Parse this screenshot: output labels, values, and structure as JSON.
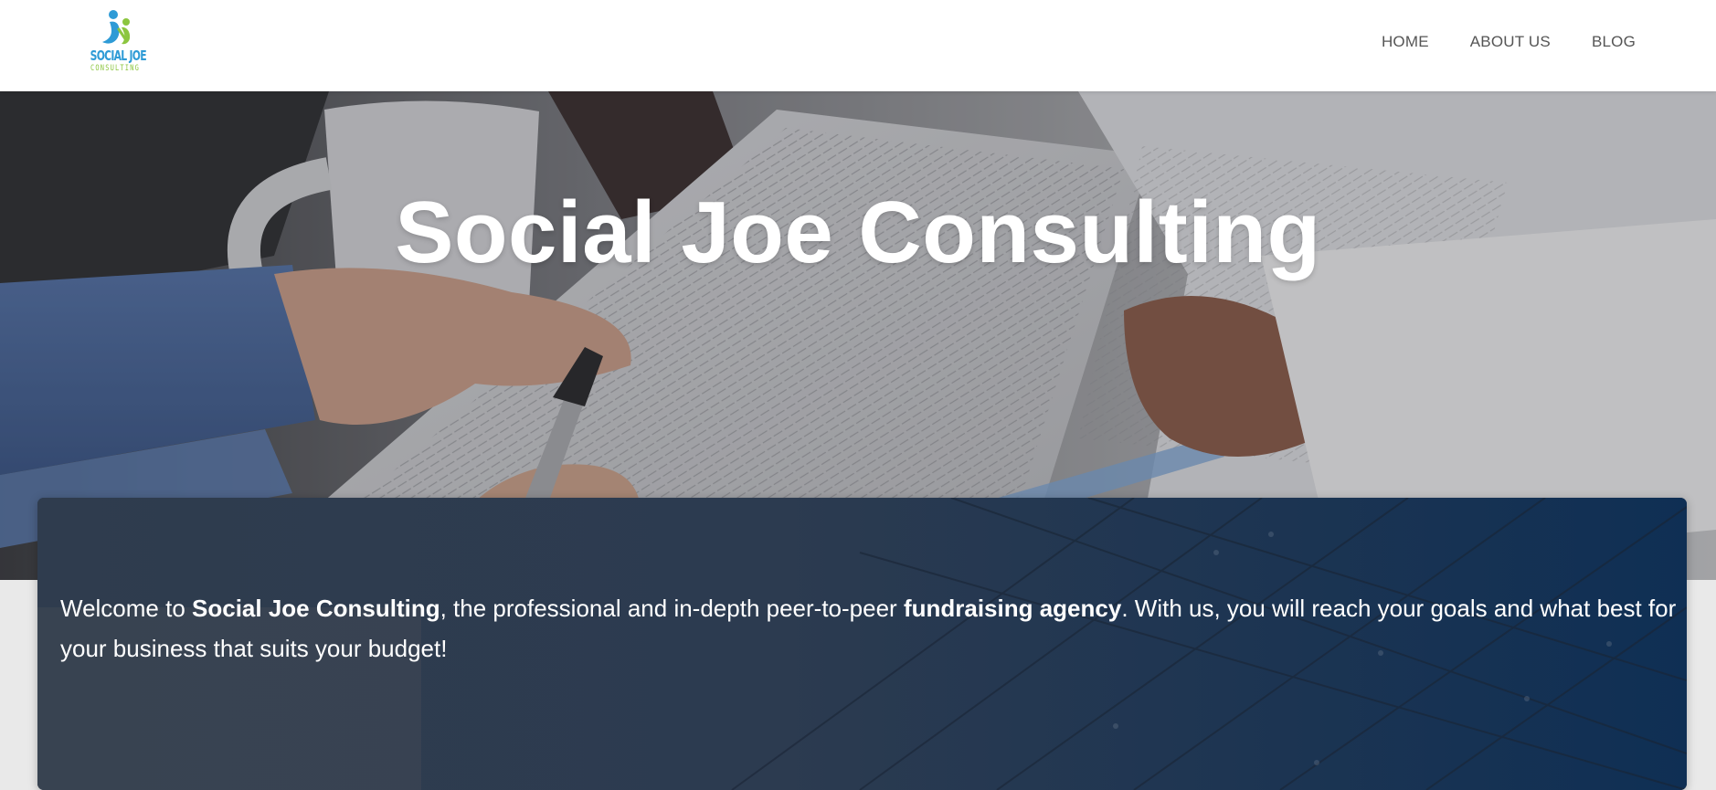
{
  "header": {
    "logo": {
      "line1": "SOCIAL JOE",
      "line2": "CONSULTING",
      "colors": {
        "blue": "#2e9bd6",
        "green": "#8cc63f"
      }
    },
    "nav": [
      {
        "label": "HOME"
      },
      {
        "label": "ABOUT US"
      },
      {
        "label": "BLOG"
      }
    ]
  },
  "hero": {
    "title": "Social Joe Consulting",
    "background": "business-document-signing-photo"
  },
  "intro": {
    "part1": "Welcome to ",
    "brand": "Social Joe Consulting",
    "part2": ", the professional and in-depth peer-to-peer ",
    "keyword": "fundraising agency",
    "part3": ". With us, you will reach your goals and what best for your business that suits your budget!"
  },
  "colors": {
    "header_bg": "#ffffff",
    "nav_text": "#555555",
    "card_bg": "#28384d",
    "page_bg": "#e9e9e9"
  }
}
